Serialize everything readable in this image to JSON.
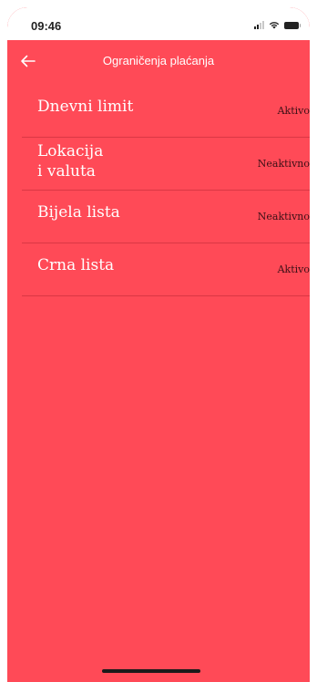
{
  "status_bar": {
    "time": "09:46",
    "icons": [
      "signal-icon",
      "wifi-icon",
      "battery-icon"
    ]
  },
  "header": {
    "back_icon": "arrow-left-icon",
    "title": "Ograničenja plaćanja"
  },
  "items": [
    {
      "label": "Dnevni limit",
      "status": "Aktivo"
    },
    {
      "label": "Lokacija\ni valuta",
      "status": "Neaktivno"
    },
    {
      "label": "Bijela lista",
      "status": "Neaktivno"
    },
    {
      "label": "Crna lista",
      "status": "Aktivo"
    }
  ],
  "colors": {
    "background": "#ff4a57",
    "status_text": "#3a1016",
    "label_text": "#ffffff"
  }
}
